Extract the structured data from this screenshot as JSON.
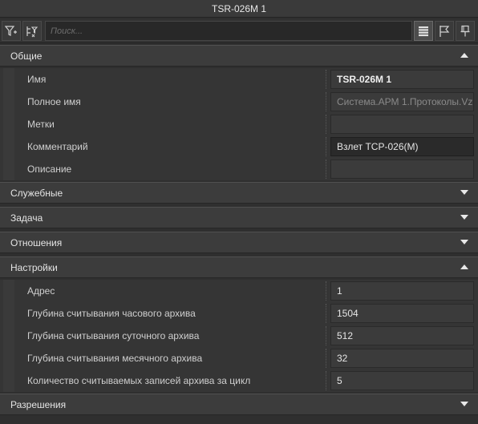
{
  "window": {
    "title": "TSR-026M 1"
  },
  "toolbar": {
    "search_placeholder": "Поиск...",
    "icons": [
      "filter-icon",
      "tree-filter-icon",
      "list-view-icon",
      "flag-icon",
      "pin-icon"
    ]
  },
  "sections": {
    "general": {
      "label": "Общие",
      "expanded": true,
      "props": [
        {
          "name": "Имя",
          "value": "TSR-026M 1"
        },
        {
          "name": "Полное имя",
          "value": "Система.АРМ 1.Протоколы.Vz"
        },
        {
          "name": "Метки",
          "value": ""
        },
        {
          "name": "Комментарий",
          "value": "Взлет ТСР-026(М)"
        },
        {
          "name": "Описание",
          "value": ""
        }
      ]
    },
    "service": {
      "label": "Служебные",
      "expanded": false
    },
    "task": {
      "label": "Задача",
      "expanded": false
    },
    "relations": {
      "label": "Отношения",
      "expanded": false
    },
    "settings": {
      "label": "Настройки",
      "expanded": true,
      "props": [
        {
          "name": "Адрес",
          "value": "1"
        },
        {
          "name": "Глубина считывания часового архива",
          "value": "1504"
        },
        {
          "name": "Глубина считывания суточного архива",
          "value": "512"
        },
        {
          "name": "Глубина считывания месячного архива",
          "value": "32"
        },
        {
          "name": "Количество считываемых записей архива за цикл",
          "value": "5"
        }
      ]
    },
    "permissions": {
      "label": "Разрешения",
      "expanded": false
    }
  }
}
